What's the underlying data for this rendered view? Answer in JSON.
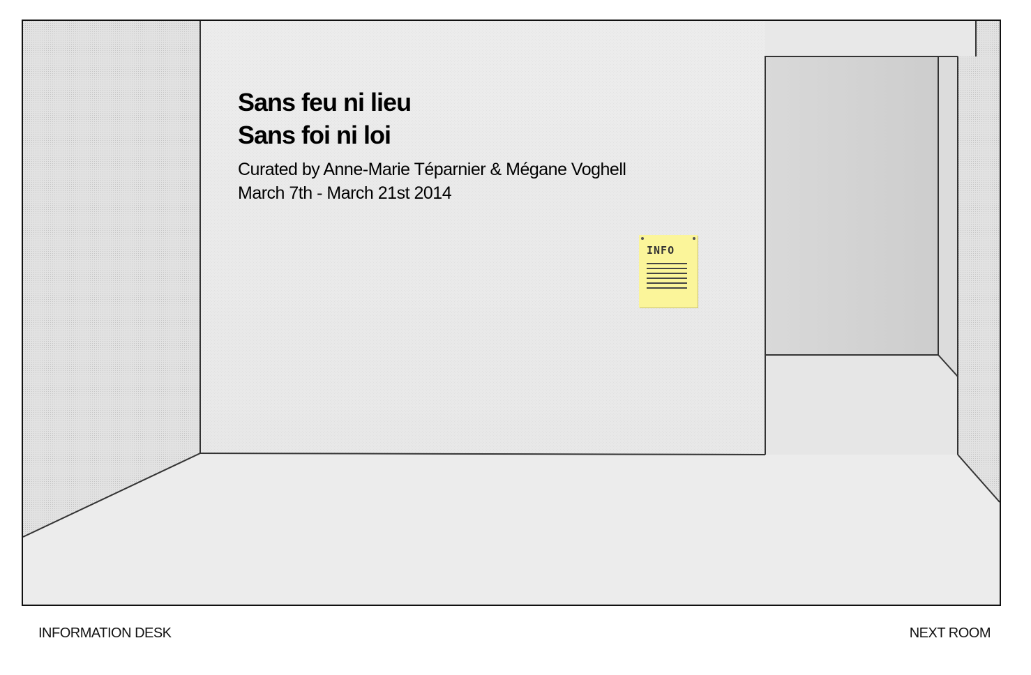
{
  "exhibition": {
    "title_line_1": "Sans feu ni lieu",
    "title_line_2": "Sans foi ni loi",
    "curators": "Curated by Anne-Marie Téparnier & Mégane Voghell",
    "dates": "March 7th - March 21st 2014"
  },
  "info_note": {
    "label": "INFO",
    "icon": "info-sheet-icon",
    "color": "#fbf59a"
  },
  "navigation": {
    "left_label": "INFORMATION DESK",
    "right_label": "NEXT ROOM"
  }
}
